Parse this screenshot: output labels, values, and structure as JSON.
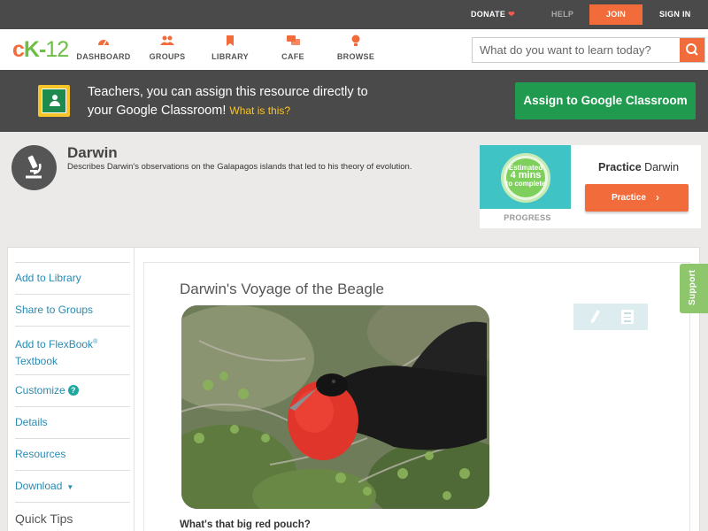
{
  "topbar": {
    "donate": "DONATE",
    "help": "HELP",
    "join": "JOIN",
    "signin": "SIGN IN"
  },
  "logo": {
    "c": "c",
    "k": "K",
    "dash": "-",
    "num": "12"
  },
  "nav": {
    "items": [
      {
        "label": "DASHBOARD",
        "icon": "dashboard-icon"
      },
      {
        "label": "GROUPS",
        "icon": "groups-icon"
      },
      {
        "label": "LIBRARY",
        "icon": "library-icon"
      },
      {
        "label": "CAFE",
        "icon": "cafe-icon"
      },
      {
        "label": "BROWSE",
        "icon": "browse-icon"
      }
    ]
  },
  "search": {
    "placeholder": "What do you want to learn today?"
  },
  "banner": {
    "line1": "Teachers, you can assign this resource directly to",
    "line2": "your Google Classroom!",
    "whatis": "What is this?",
    "button": "Assign to Google Classroom"
  },
  "concept": {
    "title": "Darwin",
    "description": "Describes Darwin's observations on the Galapagos islands that led to his theory of evolution."
  },
  "practice": {
    "estimated": "Estimated",
    "mins": "4 mins",
    "to_complete": "to complete",
    "progress_label": "PROGRESS",
    "title_bold": "Practice",
    "title_rest": "Darwin",
    "button": "Practice"
  },
  "sidebar": {
    "add_library": "Add to Library",
    "share_groups": "Share to Groups",
    "add_flexbook_1": "Add to FlexBook",
    "add_flexbook_sup": "®",
    "add_flexbook_2": "Textbook",
    "customize": "Customize",
    "details": "Details",
    "resources": "Resources",
    "download": "Download",
    "quick_tips": "Quick Tips"
  },
  "content": {
    "section_title": "Darwin's Voyage of the Beagle",
    "question": "What's that big red pouch?"
  },
  "support": "Support",
  "colors": {
    "accent": "#f26b3a",
    "green": "#1f9a4f",
    "dark": "#4a4a4a",
    "link": "#2a8ab0"
  }
}
